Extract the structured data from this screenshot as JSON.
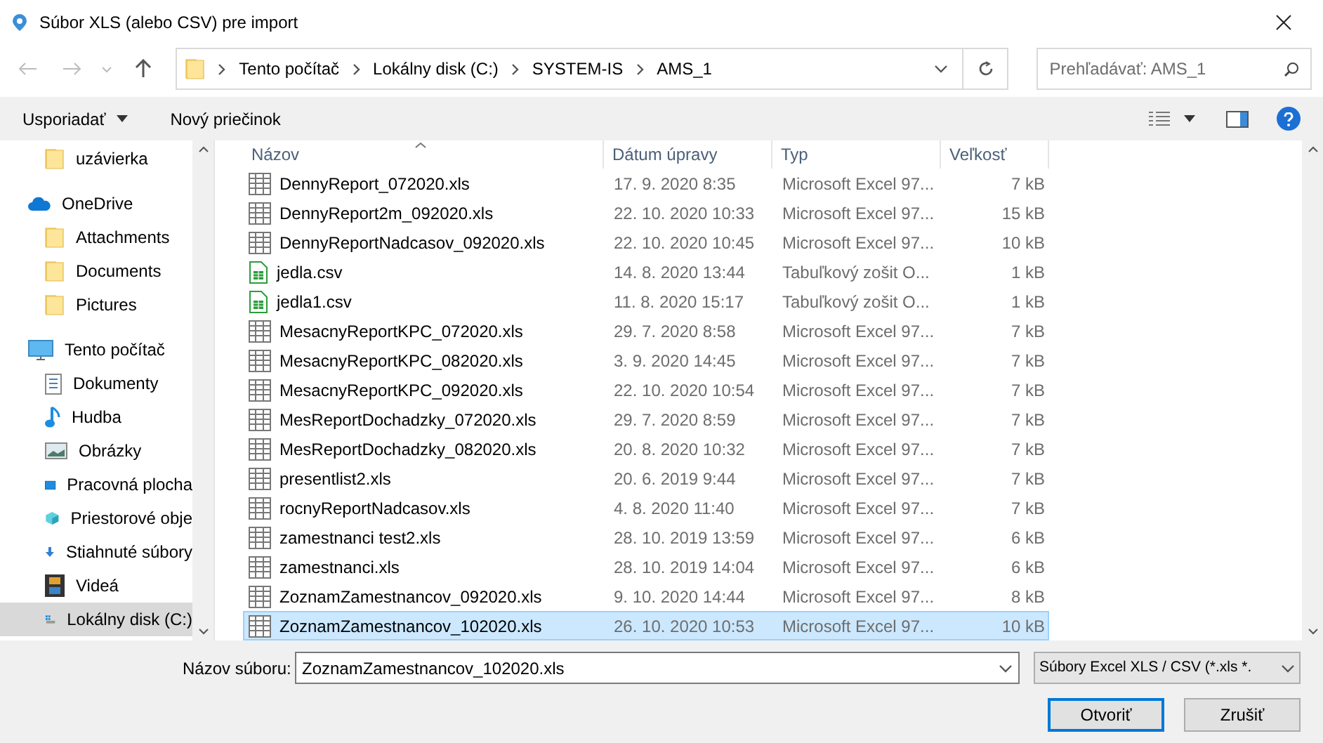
{
  "window": {
    "title": "Súbor XLS (alebo CSV) pre import"
  },
  "address": {
    "segments": [
      "Tento počítač",
      "Lokálny disk (C:)",
      "SYSTEM-IS",
      "AMS_1"
    ]
  },
  "search": {
    "placeholder": "Prehľadávať: AMS_1"
  },
  "toolbar": {
    "organize": "Usporiadať",
    "new_folder": "Nový priečinok"
  },
  "sidebar": {
    "items": [
      {
        "label": "uzávierka",
        "kind": "folder",
        "selected": false
      },
      {
        "label": "OneDrive",
        "kind": "cloud",
        "selected": false,
        "children": [
          {
            "label": "Attachments",
            "kind": "folder",
            "selected": false
          },
          {
            "label": "Documents",
            "kind": "folder",
            "selected": false
          },
          {
            "label": "Pictures",
            "kind": "folder",
            "selected": false
          }
        ]
      },
      {
        "label": "Tento počítač",
        "kind": "pc",
        "selected": false,
        "children": [
          {
            "label": "Dokumenty",
            "kind": "docs",
            "selected": false
          },
          {
            "label": "Hudba",
            "kind": "music",
            "selected": false
          },
          {
            "label": "Obrázky",
            "kind": "pictures",
            "selected": false
          },
          {
            "label": "Pracovná plocha",
            "kind": "desktop",
            "selected": false
          },
          {
            "label": "Priestorové obje",
            "kind": "objects3d",
            "selected": false
          },
          {
            "label": "Stiahnuté súbory",
            "kind": "download",
            "selected": false
          },
          {
            "label": "Videá",
            "kind": "video",
            "selected": false
          },
          {
            "label": "Lokálny disk (C:)",
            "kind": "disk",
            "selected": true
          }
        ]
      }
    ]
  },
  "table": {
    "columns": [
      "Názov",
      "Dátum úpravy",
      "Typ",
      "Veľkosť"
    ],
    "rows": [
      {
        "name": "DennyReport_072020.xls",
        "date": "17. 9. 2020 8:35",
        "type": "Microsoft Excel 97...",
        "size": "7 kB",
        "kind": "xls",
        "selected": false
      },
      {
        "name": "DennyReport2m_092020.xls",
        "date": "22. 10. 2020 10:33",
        "type": "Microsoft Excel 97...",
        "size": "15 kB",
        "kind": "xls",
        "selected": false
      },
      {
        "name": "DennyReportNadcasov_092020.xls",
        "date": "22. 10. 2020 10:45",
        "type": "Microsoft Excel 97...",
        "size": "10 kB",
        "kind": "xls",
        "selected": false
      },
      {
        "name": "jedla.csv",
        "date": "14. 8. 2020 13:44",
        "type": "Tabuľkový zošit O...",
        "size": "1 kB",
        "kind": "csv",
        "selected": false
      },
      {
        "name": "jedla1.csv",
        "date": "11. 8. 2020 15:17",
        "type": "Tabuľkový zošit O...",
        "size": "1 kB",
        "kind": "csv",
        "selected": false
      },
      {
        "name": "MesacnyReportKPC_072020.xls",
        "date": "29. 7. 2020 8:58",
        "type": "Microsoft Excel 97...",
        "size": "7 kB",
        "kind": "xls",
        "selected": false
      },
      {
        "name": "MesacnyReportKPC_082020.xls",
        "date": "3. 9. 2020 14:45",
        "type": "Microsoft Excel 97...",
        "size": "7 kB",
        "kind": "xls",
        "selected": false
      },
      {
        "name": "MesacnyReportKPC_092020.xls",
        "date": "22. 10. 2020 10:54",
        "type": "Microsoft Excel 97...",
        "size": "7 kB",
        "kind": "xls",
        "selected": false
      },
      {
        "name": "MesReportDochadzky_072020.xls",
        "date": "29. 7. 2020 8:59",
        "type": "Microsoft Excel 97...",
        "size": "7 kB",
        "kind": "xls",
        "selected": false
      },
      {
        "name": "MesReportDochadzky_082020.xls",
        "date": "20. 8. 2020 10:32",
        "type": "Microsoft Excel 97...",
        "size": "7 kB",
        "kind": "xls",
        "selected": false
      },
      {
        "name": "presentlist2.xls",
        "date": "20. 6. 2019 9:44",
        "type": "Microsoft Excel 97...",
        "size": "7 kB",
        "kind": "xls",
        "selected": false
      },
      {
        "name": "rocnyReportNadcasov.xls",
        "date": "4. 8. 2020 11:40",
        "type": "Microsoft Excel 97...",
        "size": "7 kB",
        "kind": "xls",
        "selected": false
      },
      {
        "name": "zamestnanci test2.xls",
        "date": "28. 10. 2019 13:59",
        "type": "Microsoft Excel 97...",
        "size": "6 kB",
        "kind": "xls",
        "selected": false
      },
      {
        "name": "zamestnanci.xls",
        "date": "28. 10. 2019 14:04",
        "type": "Microsoft Excel 97...",
        "size": "6 kB",
        "kind": "xls",
        "selected": false
      },
      {
        "name": "ZoznamZamestnancov_092020.xls",
        "date": "9. 10. 2020 14:44",
        "type": "Microsoft Excel 97...",
        "size": "8 kB",
        "kind": "xls",
        "selected": false
      },
      {
        "name": "ZoznamZamestnancov_102020.xls",
        "date": "26. 10. 2020 10:53",
        "type": "Microsoft Excel 97...",
        "size": "10 kB",
        "kind": "xls",
        "selected": true
      }
    ]
  },
  "file_name": {
    "label": "Názov súboru:",
    "value": "ZoznamZamestnancov_102020.xls"
  },
  "filter": {
    "value": "Súbory Excel XLS / CSV (*.xls *."
  },
  "buttons": [
    {
      "label": "Otvoriť",
      "default": true
    },
    {
      "label": "Zrušiť",
      "default": false
    }
  ]
}
